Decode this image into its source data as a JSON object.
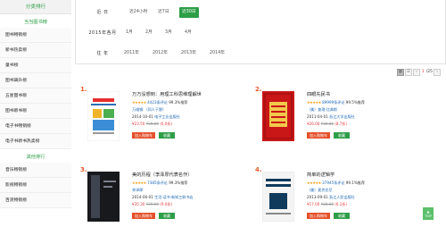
{
  "sidebar": {
    "heading": "分类排行",
    "sections": [
      {
        "title": "当当图书榜",
        "items": [
          "图书畅销榜",
          "新书热卖榜",
          "童书榜",
          "图书飙升榜",
          "五星图书榜",
          "图书新书榜",
          "电子书畅销榜",
          "电子书新书热卖榜"
        ]
      },
      {
        "title": "其他排行",
        "items": [
          "音乐畅销榜",
          "影视畅销榜",
          "百货畅销榜"
        ]
      }
    ]
  },
  "filter": {
    "rows": [
      {
        "label": "近 日",
        "options": [
          "近24小时",
          "近7日",
          "近30日"
        ],
        "active": 2
      },
      {
        "label": "2015年各月",
        "options": [
          "1月",
          "2月",
          "3月",
          "4月"
        ],
        "active": -1
      },
      {
        "label": "往 年",
        "options": [
          "2011年",
          "2012年",
          "2013年",
          "2014年"
        ],
        "active": -1
      }
    ]
  },
  "pager": {
    "current": "1",
    "total": "/25"
  },
  "cards": [
    {
      "rank": "1.",
      "title": "万万没想到：用理工科思维理解世",
      "reviews": "4423条评论",
      "rec": "99.3%推荐",
      "author": "万维钢",
      "author_note": "（同人于野）",
      "date": "2014-10-01",
      "publisher": "电子工业出版社",
      "price": "¥23.50",
      "oprice": "¥39.00",
      "discount": "(6.0折)",
      "cart": "加入购物车",
      "fav": "收藏",
      "cover_color": "#ffffff",
      "accent": "#e52d2d"
    },
    {
      "rank": "2.",
      "title": "四眼先民书",
      "reviews": "89999条评论",
      "rec": "99.5%推荐",
      "author": "（美）查理·比弗斯",
      "author_note": "",
      "date": "2011-04-01",
      "publisher": "浙江大学出版社",
      "price": "¥26.00",
      "oprice": "¥30.00",
      "discount": "(8.7折)",
      "cart": "加入购物车",
      "fav": "收藏",
      "cover_color": "#c91616",
      "accent": "#f2c94c"
    },
    {
      "rank": "3.",
      "title": "美的历程（李泽厚代表名作）",
      "reviews": "7385条评论",
      "rec": "99.3%推荐",
      "author": "李泽厚",
      "author_note": "",
      "date": "2014-06-01",
      "publisher": "生活·读书·新知三联书店",
      "price": "¥35.30",
      "oprice": "¥39.00",
      "discount": "(9.0折)",
      "cart": "加入购物车",
      "fav": "收藏",
      "cover_color": "#17191c",
      "accent": "#3f4550"
    },
    {
      "rank": "4.",
      "title": "简单的逻辑学",
      "reviews": "37945条评论",
      "rec": "99.1%推荐",
      "author": "（美）麦克伦尼",
      "author_note": "",
      "date": "2013-09-01",
      "publisher": "浙江人民出版社",
      "price": "¥17.00",
      "oprice": "¥28.00",
      "discount": "(6.1折)",
      "cart": "加入购物车",
      "fav": "收藏",
      "cover_color": "#f4f4f4",
      "accent": "#0f3a5c"
    }
  ],
  "back_to_top": "TOP"
}
